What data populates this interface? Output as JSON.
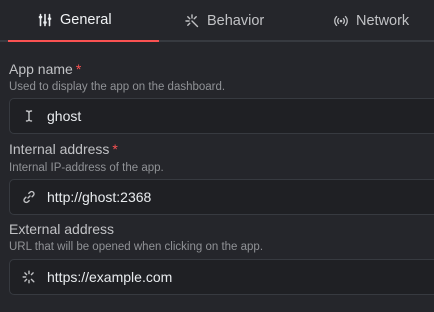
{
  "tabs": [
    {
      "label": "General",
      "icon": "sliders-icon",
      "active": true
    },
    {
      "label": "Behavior",
      "icon": "sparkle-icon",
      "active": false
    },
    {
      "label": "Network",
      "icon": "broadcast-icon",
      "active": false
    }
  ],
  "fields": {
    "app_name": {
      "label": "App name",
      "required_mark": "*",
      "description": "Used to display the app on the dashboard.",
      "value": "ghost",
      "icon": "text-cursor-icon"
    },
    "internal_address": {
      "label": "Internal address",
      "required_mark": "*",
      "description": "Internal IP-address of the app.",
      "value": "http://ghost:2368",
      "icon": "link-icon"
    },
    "external_address": {
      "label": "External address",
      "description": "URL that will be opened when clicking on the app.",
      "value": "https://example.com",
      "icon": "loader-icon"
    }
  },
  "colors": {
    "background": "#25262b",
    "accent": "#fa5252",
    "input_background": "#1f2024",
    "border": "#373a40"
  }
}
